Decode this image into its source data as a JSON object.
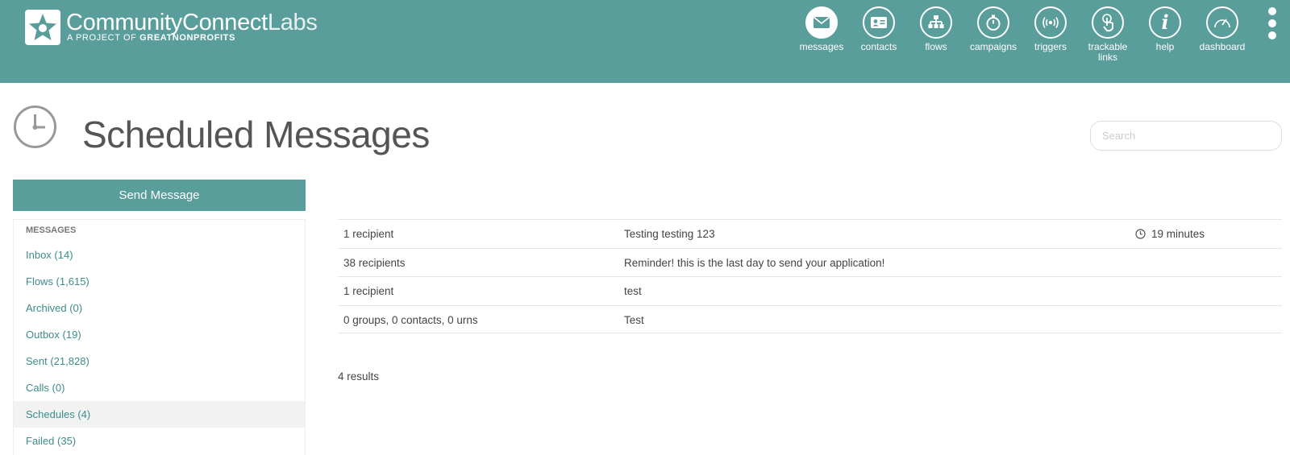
{
  "header": {
    "brand_main": "CommunityConnect",
    "brand_suffix": "Labs",
    "brand_sub_prefix": "A PROJECT OF ",
    "brand_sub_org": "GREATNONPROFITS",
    "background_color": "#5a9e9b",
    "nav": [
      {
        "label": "messages",
        "icon": "envelope-icon",
        "active": true
      },
      {
        "label": "contacts",
        "icon": "contact-card-icon"
      },
      {
        "label": "flows",
        "icon": "flow-tree-icon"
      },
      {
        "label": "campaigns",
        "icon": "stopwatch-icon"
      },
      {
        "label": "triggers",
        "icon": "broadcast-icon"
      },
      {
        "label": "trackable links",
        "icon": "tap-link-icon"
      },
      {
        "label": "help",
        "icon": "info-icon"
      },
      {
        "label": "dashboard",
        "icon": "gauge-icon"
      }
    ],
    "more_icon": "vertical-dots-icon"
  },
  "page": {
    "title": "Scheduled Messages",
    "title_icon": "clock-icon",
    "search_placeholder": "Search"
  },
  "sidebar": {
    "send_button": "Send Message",
    "heading": "MESSAGES",
    "items": [
      {
        "label": "Inbox (14)"
      },
      {
        "label": "Flows (1,615)"
      },
      {
        "label": "Archived (0)"
      },
      {
        "label": "Outbox (19)"
      },
      {
        "label": "Sent (21,828)"
      },
      {
        "label": "Calls (0)"
      },
      {
        "label": "Schedules (4)",
        "active": true
      },
      {
        "label": "Failed (35)"
      }
    ]
  },
  "schedules": {
    "rows": [
      {
        "recipients": "1 recipient",
        "message": "Testing testing 123",
        "time": "19 minutes"
      },
      {
        "recipients": "38 recipients",
        "message": "Reminder! this is the last day to send your application!",
        "time": ""
      },
      {
        "recipients": "1 recipient",
        "message": "test",
        "time": ""
      },
      {
        "recipients": "0 groups, 0 contacts, 0 urns",
        "message": "Test",
        "time": ""
      }
    ],
    "results": "4 results"
  }
}
